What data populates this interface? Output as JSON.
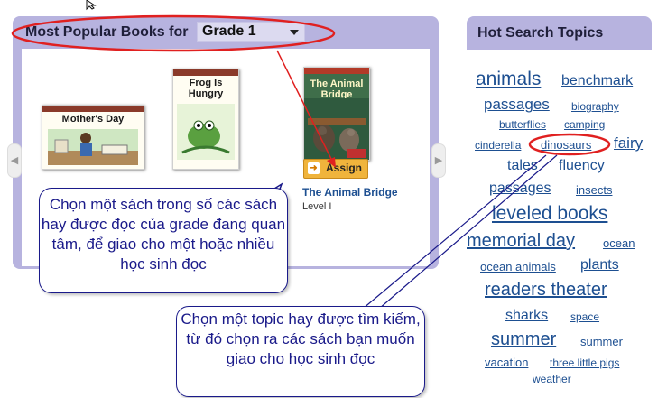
{
  "popular": {
    "title": "Most Popular Books for",
    "grade": "Grade 1",
    "books": [
      {
        "cover_title": "Mother's Day"
      },
      {
        "cover_title": "Frog Is Hungry"
      },
      {
        "cover_title": "The Animal Bridge"
      }
    ],
    "assign_label": "Assign",
    "selected_book": {
      "name": "The Animal Bridge",
      "level": "Level I"
    }
  },
  "hot_topics": {
    "title": "Hot Search Topics",
    "tags": [
      {
        "label": "animals"
      },
      {
        "label": "benchmark"
      },
      {
        "label": "passages"
      },
      {
        "label": "biography"
      },
      {
        "label": "butterflies"
      },
      {
        "label": "camping"
      },
      {
        "label": "cinderella"
      },
      {
        "label": "dinosaurs"
      },
      {
        "label": "fairy"
      },
      {
        "label": "tales"
      },
      {
        "label": "fluency"
      },
      {
        "label": "passages"
      },
      {
        "label": "insects"
      },
      {
        "label": "leveled books"
      },
      {
        "label": "memorial day"
      },
      {
        "label": "ocean"
      },
      {
        "label": "ocean animals"
      },
      {
        "label": "plants"
      },
      {
        "label": "readers theater"
      },
      {
        "label": "sharks"
      },
      {
        "label": "space"
      },
      {
        "label": "summer"
      },
      {
        "label": "summer"
      },
      {
        "label": "vacation"
      },
      {
        "label": "three little pigs"
      },
      {
        "label": "weather"
      }
    ]
  },
  "callouts": {
    "books": "Chọn một sách trong số các sách hay được đọc của grade đang quan tâm, để giao cho một hoặc nhiều học sinh đọc",
    "topics": "Chọn một topic hay được tìm kiếm, từ đó chọn ra các sách bạn muốn giao cho học sinh đọc"
  },
  "colors": {
    "panel": "#b7b3df",
    "link": "#1d4f91",
    "assign": "#f0b43c",
    "annotation_red": "#e02020",
    "callout_text": "#1a1a8a"
  }
}
